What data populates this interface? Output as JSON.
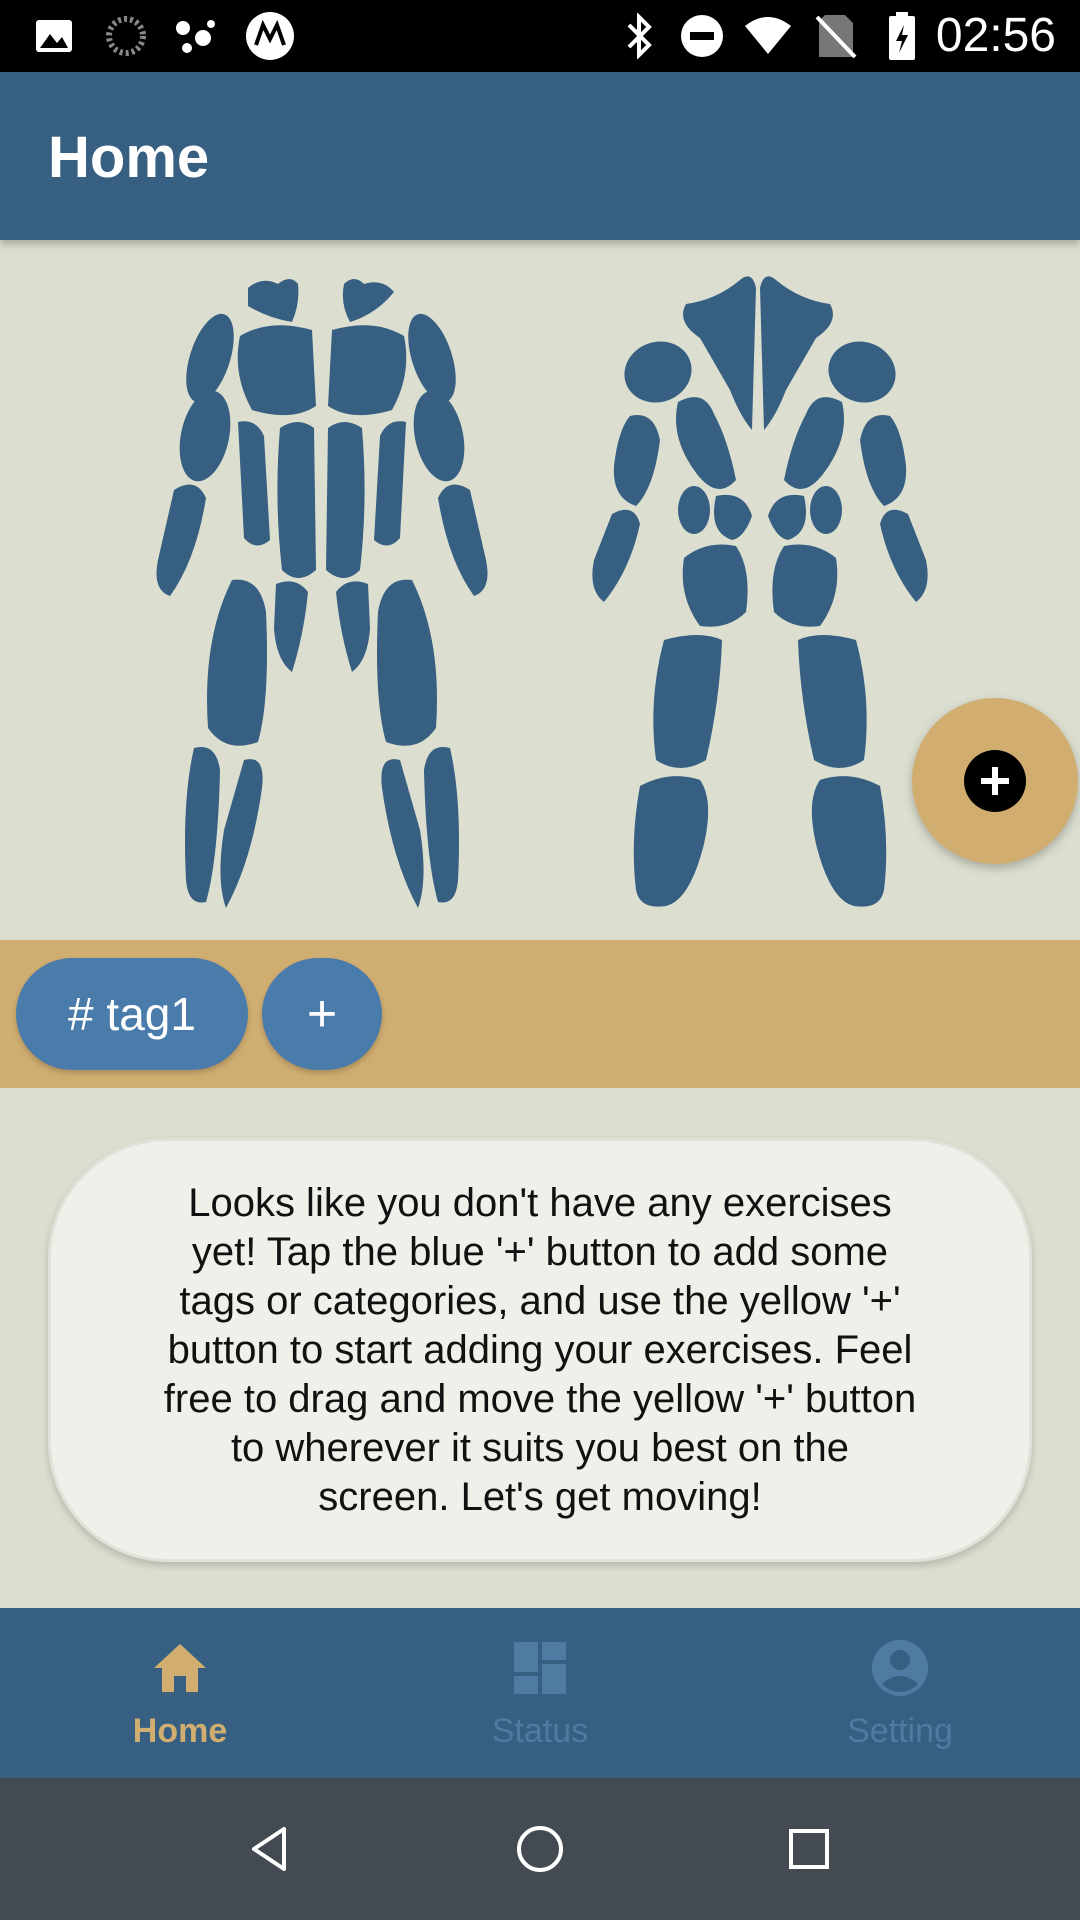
{
  "status_bar": {
    "time": "02:56",
    "icons": [
      "gallery-icon",
      "loading-icon",
      "assistant-icon",
      "motorola-icon",
      "bluetooth-icon",
      "do-not-disturb-icon",
      "wifi-icon",
      "no-sim-icon",
      "battery-charging-icon"
    ]
  },
  "app_bar": {
    "title": "Home"
  },
  "muscle_map": {
    "views": [
      "front",
      "back"
    ],
    "color": "#365f82"
  },
  "fab": {
    "icon": "plus-icon",
    "color": "#d1ae70"
  },
  "tags": {
    "items": [
      {
        "label": "# tag1"
      }
    ],
    "add_label": "+"
  },
  "empty_state": {
    "message": "Looks like you don't have any exercises yet! Tap the blue '+' button to add some tags or categories, and use the yellow '+' button to start adding your exercises. Feel free to drag and move the yellow '+' button to wherever it suits you best on the screen. Let's get moving!"
  },
  "bottom_nav": {
    "items": [
      {
        "label": "Home",
        "icon": "home-icon",
        "active": true
      },
      {
        "label": "Status",
        "icon": "dashboard-icon",
        "active": false
      },
      {
        "label": "Setting",
        "icon": "account-icon",
        "active": false
      }
    ]
  },
  "system_nav": {
    "buttons": [
      "back-icon",
      "home-circle-icon",
      "recents-icon"
    ]
  },
  "colors": {
    "primary": "#365f82",
    "accent": "#d1ae70",
    "chip": "#4a7cab",
    "background": "#dcdfd0"
  }
}
